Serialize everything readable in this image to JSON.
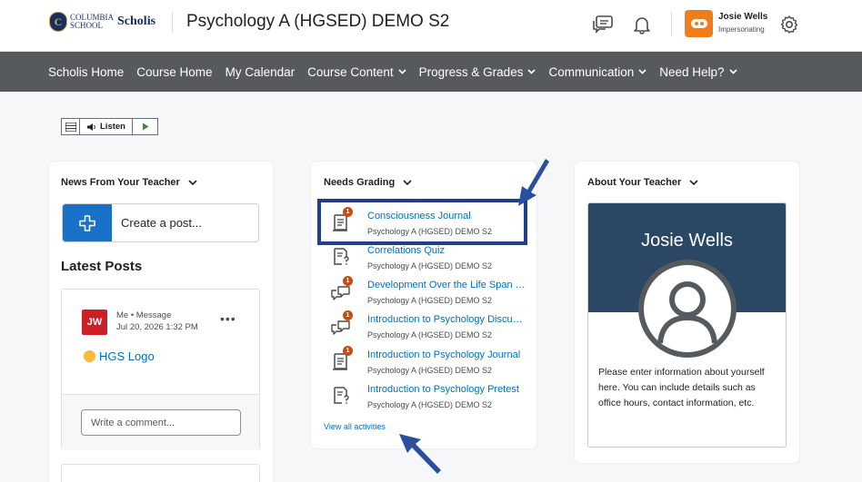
{
  "header": {
    "logo_crest": "C",
    "logo_line1": "COLUMBIA",
    "logo_line2": "SCHOOL",
    "logo_brand": "Scholis",
    "course_title": "Psychology A (HGSED) DEMO S2",
    "user_name": "Josie Wells",
    "user_status": "Impersonating",
    "icons": [
      "chat-icon",
      "bell-icon",
      "avatar-icon",
      "gear-icon"
    ]
  },
  "nav": {
    "items": [
      {
        "label": "Scholis Home",
        "dropdown": false
      },
      {
        "label": "Course Home",
        "dropdown": false
      },
      {
        "label": "My Calendar",
        "dropdown": false
      },
      {
        "label": "Course Content",
        "dropdown": true
      },
      {
        "label": "Progress & Grades",
        "dropdown": true
      },
      {
        "label": "Communication",
        "dropdown": true
      },
      {
        "label": "Need Help?",
        "dropdown": true
      }
    ]
  },
  "listen": {
    "label": "Listen"
  },
  "news": {
    "title": "News From Your Teacher",
    "create_post": "Create a post...",
    "latest_posts": "Latest Posts",
    "post": {
      "initials": "JW",
      "author_line": "Me • Message",
      "date": "Jul 20, 2026 1:32 PM",
      "more": "•••",
      "link_text": "HGS Logo",
      "comment_placeholder": "Write a comment..."
    }
  },
  "grading": {
    "title": "Needs Grading",
    "items": [
      {
        "title": "Consciousness Journal",
        "course": "Psychology A (HGSED) DEMO S2",
        "type": "journal",
        "badge": "1"
      },
      {
        "title": "Correlations Quiz",
        "course": "Psychology A (HGSED) DEMO S2",
        "type": "quiz",
        "badge": ""
      },
      {
        "title": "Development Over the Life Span Discussion",
        "course": "Psychology A (HGSED) DEMO S2",
        "type": "discussion",
        "badge": "1"
      },
      {
        "title": "Introduction to Psychology Discussion",
        "course": "Psychology A (HGSED) DEMO S2",
        "type": "discussion",
        "badge": "1"
      },
      {
        "title": "Introduction to Psychology Journal",
        "course": "Psychology A (HGSED) DEMO S2",
        "type": "journal",
        "badge": "1"
      },
      {
        "title": "Introduction to Psychology Pretest",
        "course": "Psychology A (HGSED) DEMO S2",
        "type": "quiz",
        "badge": ""
      }
    ],
    "view_all": "View all activities"
  },
  "about": {
    "title": "About Your Teacher",
    "name": "Josie Wells",
    "description": "Please enter information about yourself here. You can include details such as office hours, contact information, etc."
  },
  "colors": {
    "nav_bg": "#575a5d",
    "link": "#006fbf",
    "accent_blue": "#1a72c8",
    "annotation": "#1e3f8c",
    "badge": "#cd4a0c",
    "avatar_orange": "#f07c1b",
    "teacher_header": "#2a4763"
  }
}
